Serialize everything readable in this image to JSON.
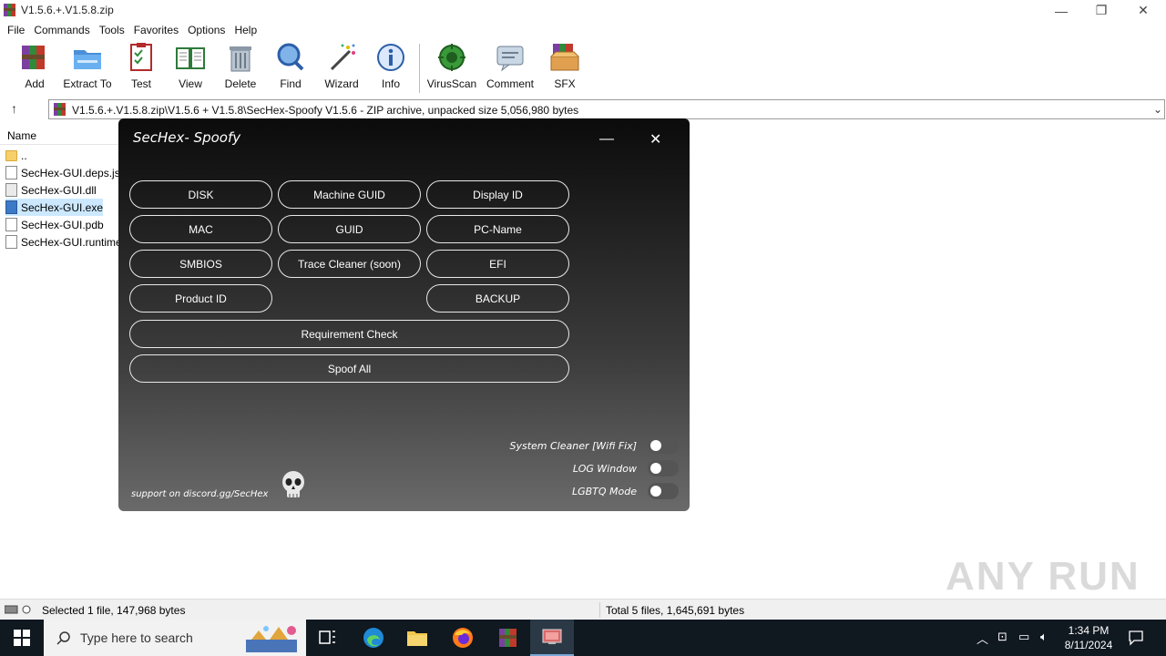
{
  "window": {
    "title": "V1.5.6.+.V1.5.8.zip",
    "controls": {
      "minimize": "—",
      "maximize": "❐",
      "close": "✕"
    }
  },
  "menu": [
    "File",
    "Commands",
    "Tools",
    "Favorites",
    "Options",
    "Help"
  ],
  "toolbar": {
    "add": "Add",
    "extract": "Extract To",
    "test": "Test",
    "view": "View",
    "delete": "Delete",
    "find": "Find",
    "wizard": "Wizard",
    "info": "Info",
    "virusscan": "VirusScan",
    "comment": "Comment",
    "sfx": "SFX"
  },
  "address": {
    "path": "V1.5.6.+.V1.5.8.zip\\V1.5.6  + V1.5.8\\SecHex-Spoofy V1.5.6 - ZIP archive, unpacked size 5,056,980 bytes"
  },
  "filelist": {
    "header": "Name",
    "rows": [
      {
        "name": "..",
        "type": "folder"
      },
      {
        "name": "SecHex-GUI.deps.json",
        "type": "file"
      },
      {
        "name": "SecHex-GUI.dll",
        "type": "dll"
      },
      {
        "name": "SecHex-GUI.exe",
        "type": "exe"
      },
      {
        "name": "SecHex-GUI.pdb",
        "type": "file"
      },
      {
        "name": "SecHex-GUI.runtimeconfig.json",
        "type": "file"
      }
    ]
  },
  "status": {
    "left": "Selected 1 file, 147,968 bytes",
    "right": "Total 5 files, 1,645,691 bytes"
  },
  "watermark": "ANY RUN",
  "sechex": {
    "title": "SecHex- Spoofy",
    "buttons": {
      "disk": "DISK",
      "machine_guid": "Machine GUID",
      "display_id": "Display ID",
      "mac": "MAC",
      "guid": "GUID",
      "pc_name": "PC-Name",
      "smbios": "SMBIOS",
      "trace_cleaner": "Trace Cleaner (soon)",
      "efi": "EFI",
      "product_id": "Product ID",
      "backup": "BACKUP",
      "requirement_check": "Requirement Check",
      "spoof_all": "Spoof All"
    },
    "toggles": {
      "system_cleaner": "System Cleaner [Wifi Fix]",
      "log_window": "LOG Window",
      "lgbtq_mode": "LGBTQ Mode"
    },
    "support": "support on discord.gg/SecHex"
  },
  "taskbar": {
    "search_placeholder": "Type here to search",
    "time": "1:34 PM",
    "date": "8/11/2024"
  }
}
